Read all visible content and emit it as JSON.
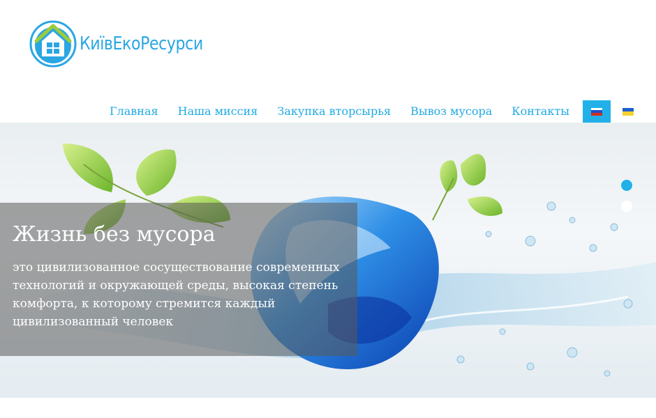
{
  "brand": {
    "name": "КиївЕкоРесурси",
    "color": "#2aa6e3"
  },
  "nav": {
    "items": [
      {
        "label": "Главная"
      },
      {
        "label": "Наша миссия"
      },
      {
        "label": "Закупка вторсырья"
      },
      {
        "label": "Вывоз мусора"
      },
      {
        "label": "Контакты"
      }
    ],
    "languages": [
      {
        "code": "ru",
        "icon": "russia-flag-icon",
        "active": true
      },
      {
        "code": "uk",
        "icon": "ukraine-flag-icon",
        "active": false
      }
    ],
    "color": "#21a9e1",
    "active_bg": "#21b1e8"
  },
  "slider": {
    "title": "Жизнь без мусора",
    "text": "это цивилизованное сосуществование современных технологий и окружающей среды, высокая степень комфорта, к которому стремится каждый цивилизованный человек",
    "slides_count": 2,
    "active_slide": 1
  }
}
